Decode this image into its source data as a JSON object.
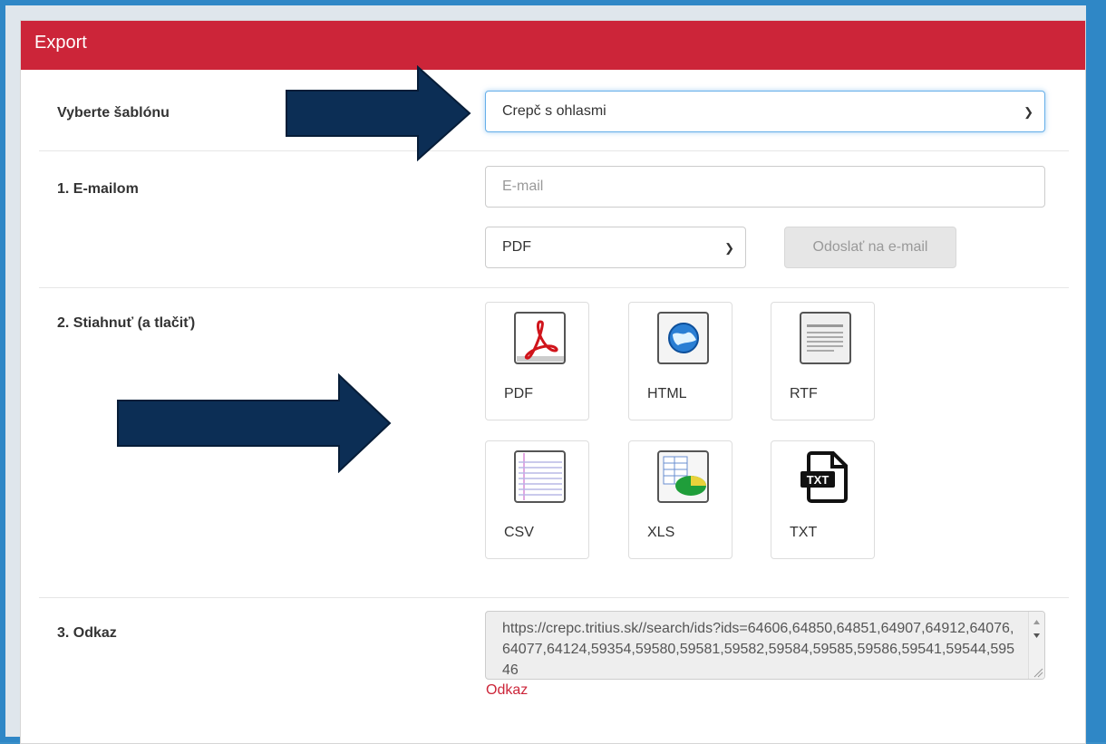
{
  "panel": {
    "title": "Export"
  },
  "template_row": {
    "label": "Vyberte šablónu",
    "selected": "Crepč s ohlasmi"
  },
  "email_row": {
    "label": "1. E-mailom",
    "email_placeholder": "E-mail",
    "format_selected": "PDF",
    "send_button": "Odoslať na e-mail"
  },
  "download_row": {
    "label": "2. Stiahnuť (a tlačiť)",
    "formats": [
      {
        "label": "PDF",
        "icon": "pdf-icon"
      },
      {
        "label": "HTML",
        "icon": "html-globe-icon"
      },
      {
        "label": "RTF",
        "icon": "rtf-document-icon"
      },
      {
        "label": "CSV",
        "icon": "csv-lines-icon"
      },
      {
        "label": "XLS",
        "icon": "xls-spreadsheet-icon"
      },
      {
        "label": "TXT",
        "icon": "txt-file-icon"
      }
    ]
  },
  "link_row": {
    "label": "3. Odkaz",
    "url": "https://crepc.tritius.sk//search/ids?ids=64606,64850,64851,64907,64912,64076,64077,64124,59354,59580,59581,59582,59584,59585,59586,59541,59544,59546",
    "link_text": "Odkaz"
  },
  "colors": {
    "header": "#cc2539",
    "arrow": "#0c2e55",
    "frame": "#2f87c6"
  }
}
